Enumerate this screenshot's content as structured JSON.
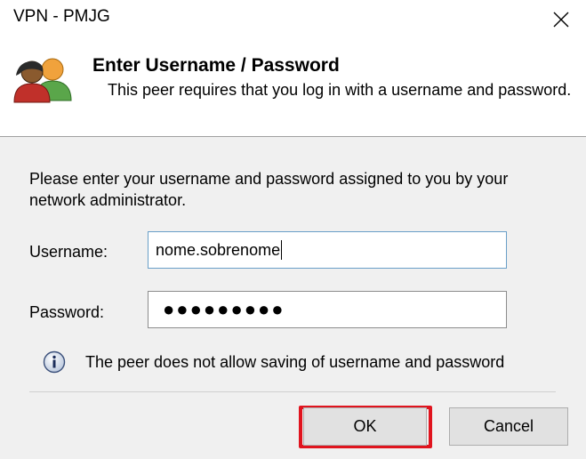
{
  "window": {
    "title": "VPN - PMJG",
    "close_icon": "close-icon"
  },
  "header": {
    "title": "Enter Username / Password",
    "description": "This peer requires that you log in with a username and password.",
    "icon": "users-icon"
  },
  "form": {
    "instructions": "Please enter your username and password assigned to you by your network administrator.",
    "username_label": "Username:",
    "username_value": "nome.sobrenome",
    "password_label": "Password:",
    "password_mask": "●●●●●●●●●"
  },
  "notice": {
    "icon": "info-icon",
    "text": "The peer does not allow saving of username and password"
  },
  "buttons": {
    "ok_label": "OK",
    "cancel_label": "Cancel"
  },
  "colors": {
    "highlight": "#e0141e",
    "focused_border": "#6a9fc8"
  }
}
